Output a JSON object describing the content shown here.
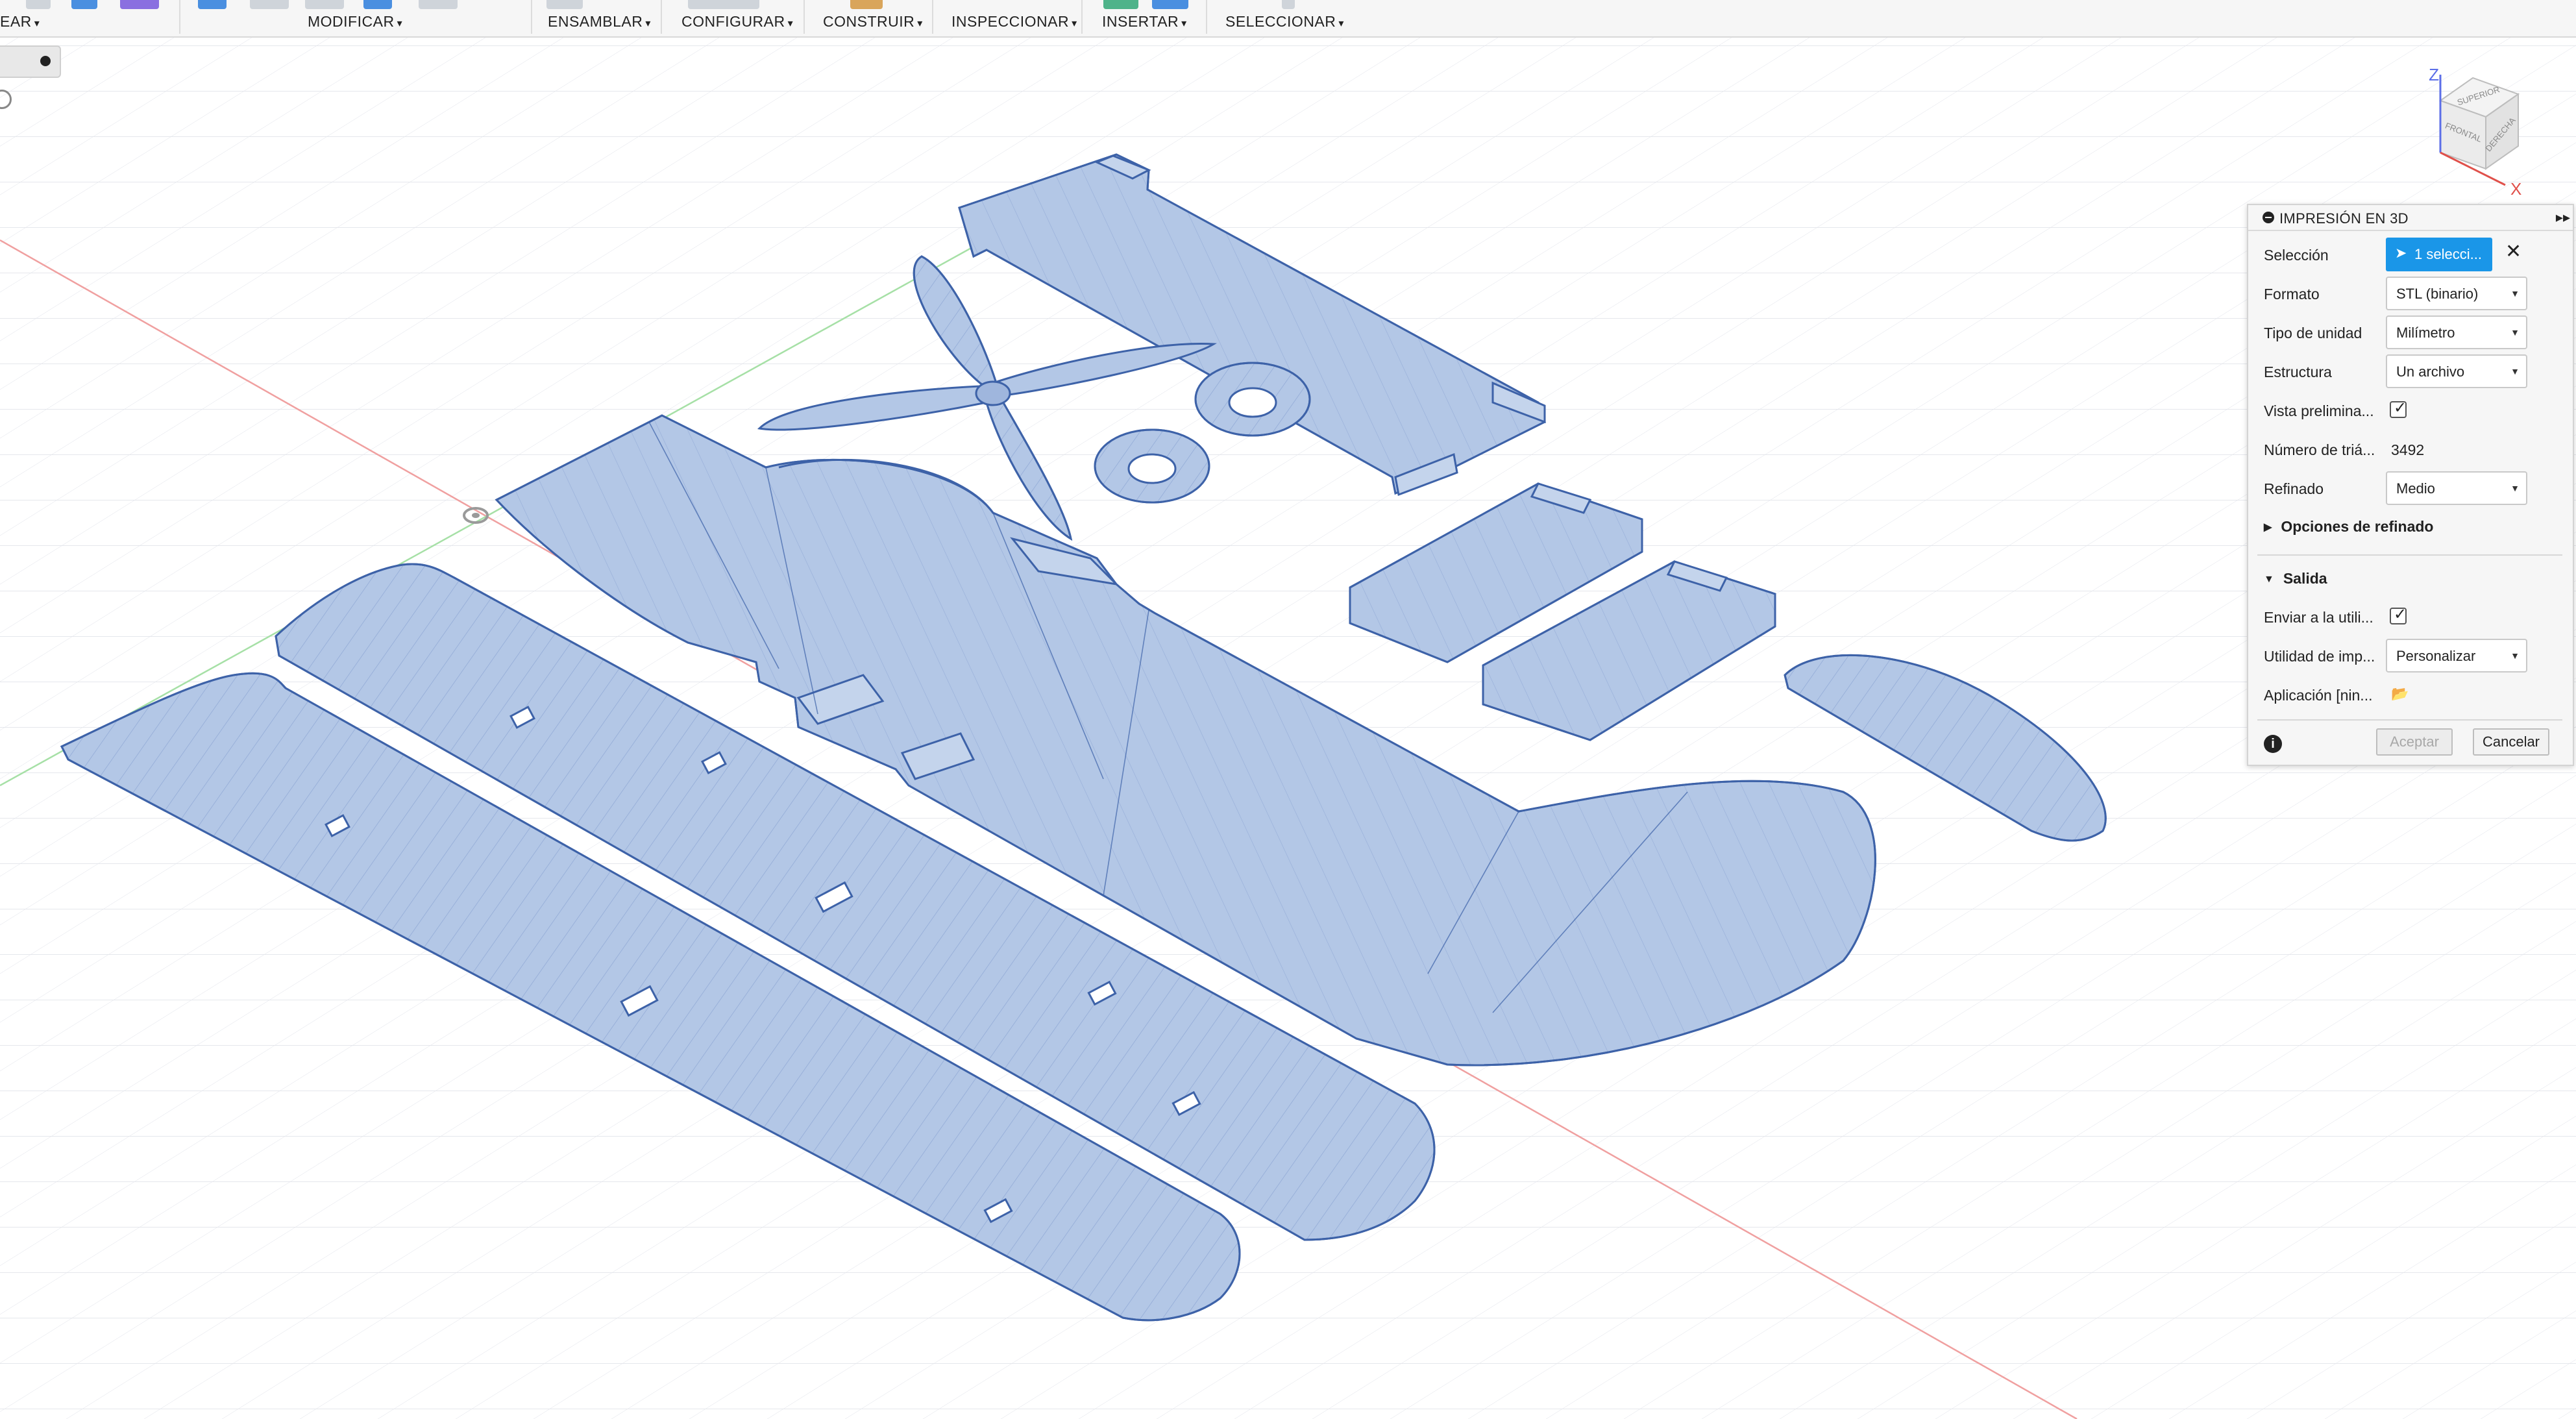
{
  "toolbar": {
    "crear_partial": "EAR",
    "modificar": "MODIFICAR",
    "ensamblar": "ENSAMBLAR",
    "configurar": "CONFIGURAR",
    "construir": "CONSTRUIR",
    "inspeccionar": "INSPECCIONAR",
    "insertar": "INSERTAR",
    "seleccionar": "SELECCIONAR",
    "caret": "▾"
  },
  "viewcube": {
    "top_face": "SUPERIOR",
    "front_face": "FRONTAL",
    "right_face": "DERECHA",
    "z_axis": "Z",
    "x_axis": "X"
  },
  "panel": {
    "title": "IMPRESIÓN EN 3D",
    "expand": "▸▸",
    "rows": {
      "seleccion_label": "Selección",
      "seleccion_value": "1 selecci...",
      "formato_label": "Formato",
      "formato_value": "STL (binario)",
      "tipo_unidad_label": "Tipo de unidad",
      "tipo_unidad_value": "Milímetro",
      "estructura_label": "Estructura",
      "estructura_value": "Un archivo",
      "vista_label": "Vista prelimina...",
      "vista_checked": true,
      "numero_label": "Número de triá...",
      "numero_value": "3492",
      "refinado_label": "Refinado",
      "refinado_value": "Medio"
    },
    "opciones_refinado": "Opciones de refinado",
    "salida": {
      "title": "Salida",
      "enviar_label": "Enviar a la utili...",
      "enviar_checked": true,
      "utilidad_label": "Utilidad de imp...",
      "utilidad_value": "Personalizar",
      "aplicacion_label": "Aplicación [nin..."
    },
    "accept": "Aceptar",
    "cancel": "Cancelar",
    "info": "i"
  },
  "colors": {
    "part_fill": "#b3c7e6",
    "part_stroke": "#3d62a8",
    "accent_blue": "#1a96e8",
    "grid": "#e6e8ee"
  }
}
